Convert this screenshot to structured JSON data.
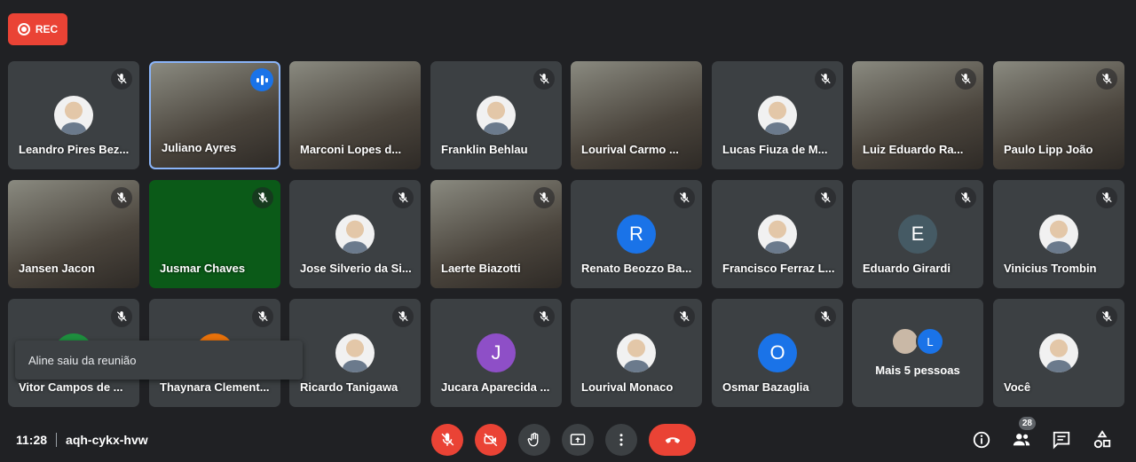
{
  "rec_label": "REC",
  "tiles": [
    {
      "name": "Leandro Pires Bez...",
      "type": "photo",
      "muted": true
    },
    {
      "name": "Juliano Ayres",
      "type": "video",
      "speaking": true
    },
    {
      "name": "Marconi Lopes d...",
      "type": "video",
      "muted": false
    },
    {
      "name": "Franklin Behlau",
      "type": "photo",
      "muted": true
    },
    {
      "name": "Lourival Carmo ...",
      "type": "video",
      "muted": false
    },
    {
      "name": "Lucas Fiuza de M...",
      "type": "photo",
      "muted": true
    },
    {
      "name": "Luiz Eduardo Ra...",
      "type": "video",
      "muted": true
    },
    {
      "name": "Paulo Lipp João",
      "type": "video",
      "muted": true
    },
    {
      "name": "Jansen Jacon",
      "type": "video",
      "muted": true
    },
    {
      "name": "Jusmar Chaves",
      "type": "green",
      "muted": true
    },
    {
      "name": "Jose Silverio da Si...",
      "type": "photo",
      "muted": true
    },
    {
      "name": "Laerte Biazotti",
      "type": "video",
      "muted": true
    },
    {
      "name": "Renato Beozzo Ba...",
      "type": "letter",
      "letter": "R",
      "color": "#1a73e8",
      "muted": true
    },
    {
      "name": "Francisco Ferraz L...",
      "type": "photo",
      "muted": true
    },
    {
      "name": "Eduardo Girardi",
      "type": "letter",
      "letter": "E",
      "color": "#455a64",
      "muted": true
    },
    {
      "name": "Vinicius Trombin",
      "type": "photo",
      "muted": true
    },
    {
      "name": "Vitor Campos de ...",
      "type": "letter",
      "letter": "",
      "color": "#1e8e3e",
      "muted": true
    },
    {
      "name": "Thaynara Clement...",
      "type": "letter",
      "letter": "",
      "color": "#e8710a",
      "muted": true
    },
    {
      "name": "Ricardo Tanigawa",
      "type": "photo",
      "muted": true
    },
    {
      "name": "Jucara Aparecida ...",
      "type": "letter",
      "letter": "J",
      "color": "#8e4fc7",
      "muted": true
    },
    {
      "name": "Lourival Monaco",
      "type": "photo",
      "muted": true
    },
    {
      "name": "Osmar Bazaglia",
      "type": "letter",
      "letter": "O",
      "color": "#1a73e8",
      "muted": true
    },
    {
      "name": "",
      "type": "more",
      "more_label": "Mais 5 pessoas",
      "more_letter": "L"
    },
    {
      "name": "Você",
      "type": "photo",
      "muted": true
    }
  ],
  "toast": "Aline saiu da reunião",
  "time": "11:28",
  "meeting_code": "aqh-cykx-hvw",
  "participants_count": "28",
  "colors": {
    "danger": "#ea4335",
    "accent": "#1a73e8",
    "tile": "#3c4043"
  }
}
